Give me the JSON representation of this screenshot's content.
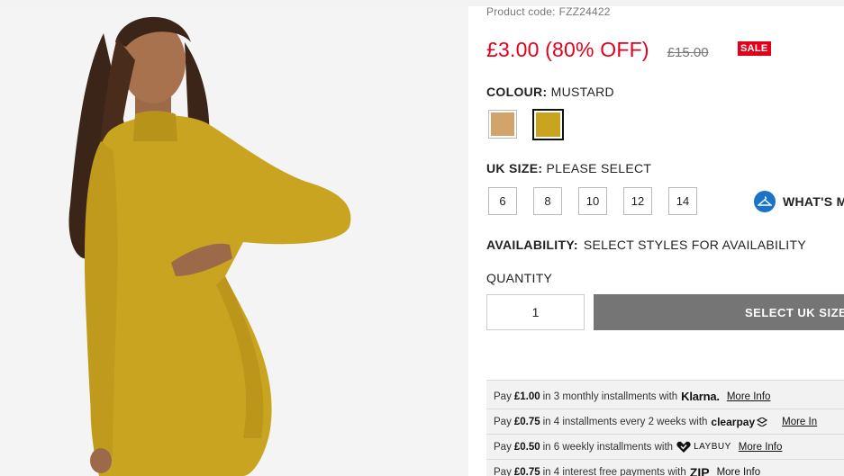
{
  "product": {
    "code_label": "Product code:",
    "code": "FZZ24422",
    "price_now": "£3.00 (80% OFF)",
    "price_was": "£15.00",
    "sale_badge": "SALE",
    "image_alt": "Mustard high neck bodycon dress"
  },
  "colour": {
    "label": "COLOUR:",
    "value": "MUSTARD",
    "swatches": [
      {
        "name": "camel",
        "color": "#d2a46b",
        "selected": false
      },
      {
        "name": "mustard",
        "color": "#c9a421",
        "selected": true
      }
    ]
  },
  "size": {
    "label": "UK SIZE:",
    "value": "PLEASE SELECT",
    "options": [
      "6",
      "8",
      "10",
      "12",
      "14"
    ],
    "whats_my_size": "WHAT'S M"
  },
  "availability": {
    "label": "AVAILABILITY:",
    "value": "SELECT STYLES FOR AVAILABILITY"
  },
  "quantity": {
    "label": "QUANTITY",
    "value": "1",
    "button": "SELECT UK SIZE"
  },
  "payments": [
    {
      "pre": "Pay",
      "amount": "£1.00",
      "text": "in 3 monthly installments with",
      "logo": "Klarna.",
      "link": "More Info"
    },
    {
      "pre": "Pay",
      "amount": "£0.75",
      "text": "in 4 installments every 2 weeks with",
      "logo": "clearpay",
      "link": "More In"
    },
    {
      "pre": "Pay",
      "amount": "£0.50",
      "text": "in 6 weekly installments with",
      "logo": "LAYBUY",
      "link": "More Info"
    },
    {
      "pre": "Pay",
      "amount": "£0.75",
      "text": "in 4 interest free payments with",
      "logo": "ZIP",
      "link": "More Info"
    }
  ],
  "colors": {
    "sale_red": "#e3001b",
    "button_grey": "#757575",
    "dress_mustard": "#c9a421",
    "hanger_blue": "#1a73c9"
  }
}
